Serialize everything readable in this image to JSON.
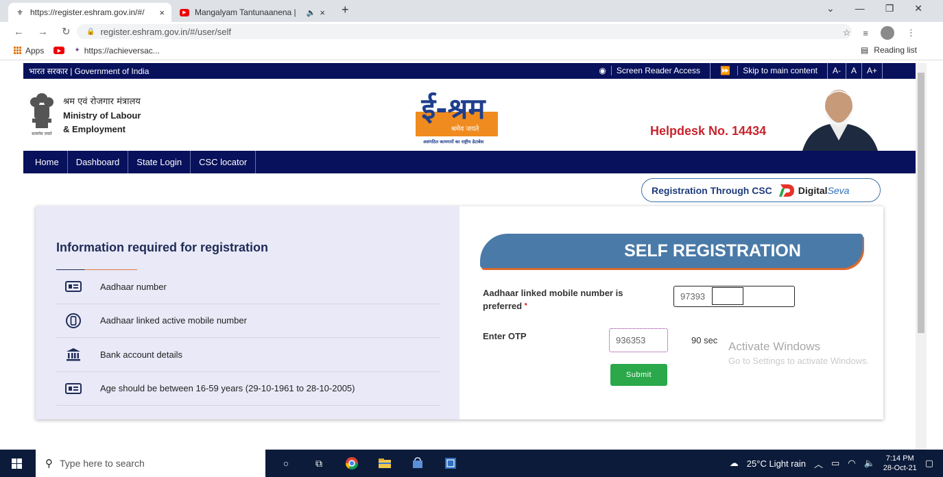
{
  "browser": {
    "tabs": [
      {
        "title": "https://register.eshram.gov.in/#/",
        "close": "×"
      },
      {
        "title": "Mangalyam Tantunaanena |",
        "close": "×"
      }
    ],
    "new_tab": "+",
    "url": "register.eshram.gov.in/#/user/self",
    "bookmarks": {
      "apps": "Apps",
      "link": "https://achieversac..."
    },
    "reading_list": "Reading list"
  },
  "gov_bar": {
    "left": "भारत सरकार | Government of India",
    "screen_reader": "Screen Reader Access",
    "skip": "Skip to main content",
    "font_small": "A-",
    "font_normal": "A",
    "font_large": "A+"
  },
  "header": {
    "ministry_hi": "श्रम एवं रोजगार मंत्रालय",
    "ministry_en_1": "Ministry of Labour",
    "ministry_en_2": "& Employment",
    "emblem_caption": "सत्यमेव जयते",
    "logo_text": "ई-श्रम",
    "logo_tagline": "श्रमेव जयते",
    "logo_sub": "असंगठित कामगारों का राष्ट्रीय डेटाबेस",
    "helpdesk": "Helpdesk No. 14434"
  },
  "nav": [
    "Home",
    "Dashboard",
    "State Login",
    "CSC locator"
  ],
  "csc": {
    "text": "Registration Through CSC",
    "digital": "Digital",
    "seva": "Seva"
  },
  "info": {
    "title": "Information required for registration",
    "items": [
      "Aadhaar number",
      "Aadhaar linked active mobile number",
      "Bank account details",
      "Age should be between 16-59 years (29-10-1961 to 28-10-2005)"
    ]
  },
  "form": {
    "banner": "SELF REGISTRATION",
    "mobile_label": "Aadhaar linked mobile number is preferred",
    "required_mark": "*",
    "mobile_value": "97393",
    "otp_label": "Enter OTP",
    "otp_value": "936353",
    "timer": "90 sec",
    "submit": "Submit"
  },
  "watermark": {
    "line1": "Activate Windows",
    "line2": "Go to Settings to activate Windows."
  },
  "taskbar": {
    "search_placeholder": "Type here to search",
    "weather": "25°C  Light rain",
    "time": "7:14 PM",
    "date": "28-Oct-21"
  },
  "colors": {
    "navy": "#08115c",
    "helpdesk_red": "#c8242e",
    "submit_green": "#2aa84a",
    "banner_blue": "#4a7aa8"
  }
}
